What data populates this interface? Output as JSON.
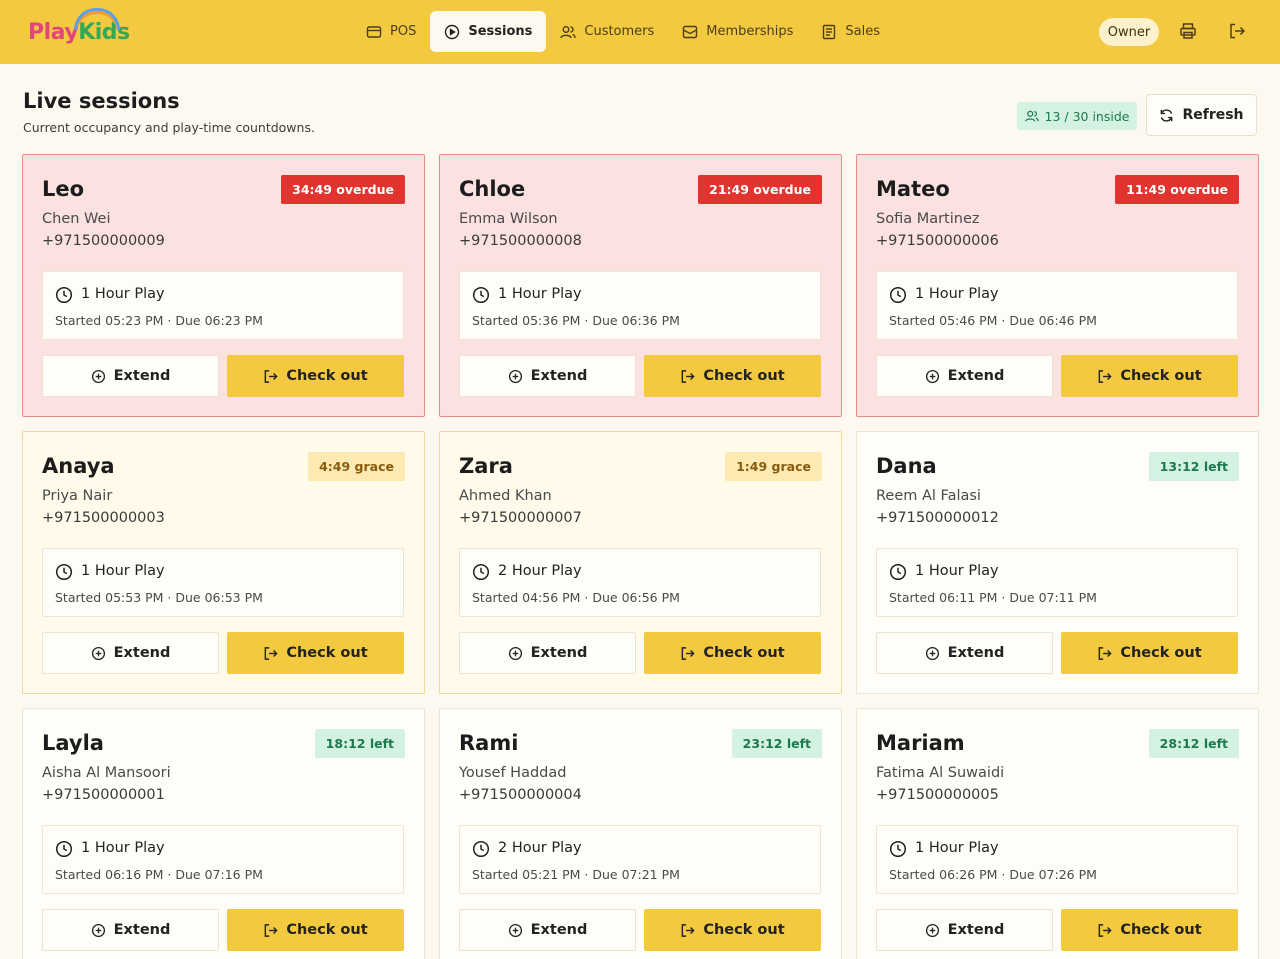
{
  "app": {
    "logo_text_a": "Play",
    "logo_text_b": "Kids"
  },
  "nav": [
    {
      "label": "POS",
      "icon": "pos-icon",
      "active": false
    },
    {
      "label": "Sessions",
      "icon": "sessions-icon",
      "active": true
    },
    {
      "label": "Customers",
      "icon": "customers-icon",
      "active": false
    },
    {
      "label": "Memberships",
      "icon": "memberships-icon",
      "active": false
    },
    {
      "label": "Sales",
      "icon": "sales-icon",
      "active": false
    }
  ],
  "header": {
    "role": "Owner"
  },
  "page": {
    "title": "Live sessions",
    "subtitle": "Current occupancy and play-time countdowns.",
    "occupancy": "13 / 30 inside",
    "refresh_label": "Refresh"
  },
  "actions": {
    "extend_label": "Extend",
    "checkout_label": "Check out"
  },
  "sessions": [
    {
      "child": "Leo",
      "status": "overdue",
      "badge": "34:49 overdue",
      "parent": "Chen Wei",
      "phone": "+971500000009",
      "plan": "1 Hour Play",
      "times": "Started 05:23 PM · Due 06:23 PM"
    },
    {
      "child": "Chloe",
      "status": "overdue",
      "badge": "21:49 overdue",
      "parent": "Emma Wilson",
      "phone": "+971500000008",
      "plan": "1 Hour Play",
      "times": "Started 05:36 PM · Due 06:36 PM"
    },
    {
      "child": "Mateo",
      "status": "overdue",
      "badge": "11:49 overdue",
      "parent": "Sofia Martinez",
      "phone": "+971500000006",
      "plan": "1 Hour Play",
      "times": "Started 05:46 PM · Due 06:46 PM"
    },
    {
      "child": "Anaya",
      "status": "grace",
      "badge": "4:49 grace",
      "parent": "Priya Nair",
      "phone": "+971500000003",
      "plan": "1 Hour Play",
      "times": "Started 05:53 PM · Due 06:53 PM"
    },
    {
      "child": "Zara",
      "status": "grace",
      "badge": "1:49 grace",
      "parent": "Ahmed Khan",
      "phone": "+971500000007",
      "plan": "2 Hour Play",
      "times": "Started 04:56 PM · Due 06:56 PM"
    },
    {
      "child": "Dana",
      "status": "left",
      "badge": "13:12 left",
      "parent": "Reem Al Falasi",
      "phone": "+971500000012",
      "plan": "1 Hour Play",
      "times": "Started 06:11 PM · Due 07:11 PM"
    },
    {
      "child": "Layla",
      "status": "left",
      "badge": "18:12 left",
      "parent": "Aisha Al Mansoori",
      "phone": "+971500000001",
      "plan": "1 Hour Play",
      "times": "Started 06:16 PM · Due 07:16 PM"
    },
    {
      "child": "Rami",
      "status": "left",
      "badge": "23:12 left",
      "parent": "Yousef Haddad",
      "phone": "+971500000004",
      "plan": "2 Hour Play",
      "times": "Started 05:21 PM · Due 07:21 PM"
    },
    {
      "child": "Mariam",
      "status": "left",
      "badge": "28:12 left",
      "parent": "Fatima Al Suwaidi",
      "phone": "+971500000005",
      "plan": "1 Hour Play",
      "times": "Started 06:26 PM · Due 07:26 PM"
    }
  ],
  "colors": {
    "brand": "#f3c93f",
    "overdue": "#e2332f",
    "grace": "#fdeab2",
    "left": "#d3f2e2"
  }
}
